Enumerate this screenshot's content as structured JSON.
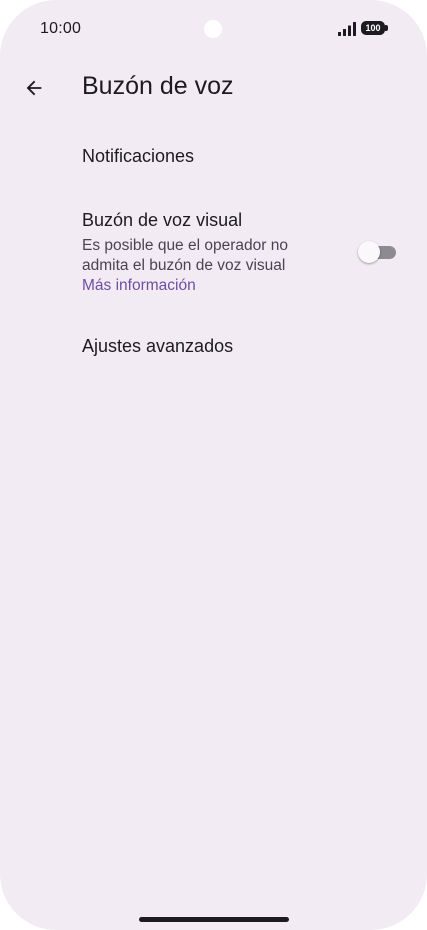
{
  "status_bar": {
    "time": "10:00",
    "battery": "100"
  },
  "app_bar": {
    "title": "Buzón de voz"
  },
  "settings": [
    {
      "title": "Notificaciones"
    },
    {
      "title": "Buzón de voz visual",
      "summary": "Es posible que el operador no admita el buzón de voz visual",
      "link": "Más información",
      "toggle_on": false
    },
    {
      "title": "Ajustes avanzados"
    }
  ],
  "colors": {
    "background": "#f2ebf3",
    "text_primary": "#1d1b20",
    "text_secondary": "#49454f",
    "link": "#6f4fa0"
  }
}
